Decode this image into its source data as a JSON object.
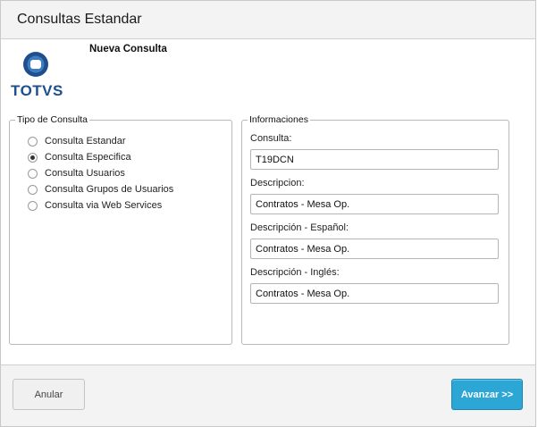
{
  "window": {
    "title": "Consultas Estandar"
  },
  "header": {
    "subtitle": "Nueva Consulta",
    "logo_text": "TOTVS"
  },
  "tipo_consulta": {
    "legend": "Tipo de Consulta",
    "options": [
      {
        "label": "Consulta Estandar",
        "selected": false
      },
      {
        "label": "Consulta Especifica",
        "selected": true
      },
      {
        "label": "Consulta Usuarios",
        "selected": false
      },
      {
        "label": "Consulta Grupos de Usuarios",
        "selected": false
      },
      {
        "label": "Consulta via Web Services",
        "selected": false
      }
    ]
  },
  "informaciones": {
    "legend": "Informaciones",
    "fields": [
      {
        "label": "Consulta:",
        "value": "T19DCN"
      },
      {
        "label": "Descripcion:",
        "value": "Contratos - Mesa Op."
      },
      {
        "label": "Descripción - Español:",
        "value": "Contratos - Mesa Op."
      },
      {
        "label": "Descripción - Inglés:",
        "value": "Contratos - Mesa Op."
      }
    ]
  },
  "buttons": {
    "cancel_label": "Anular",
    "next_label": "Avanzar >>"
  },
  "colors": {
    "accent": "#2ca6d4",
    "logo": "#1d4f8f"
  }
}
